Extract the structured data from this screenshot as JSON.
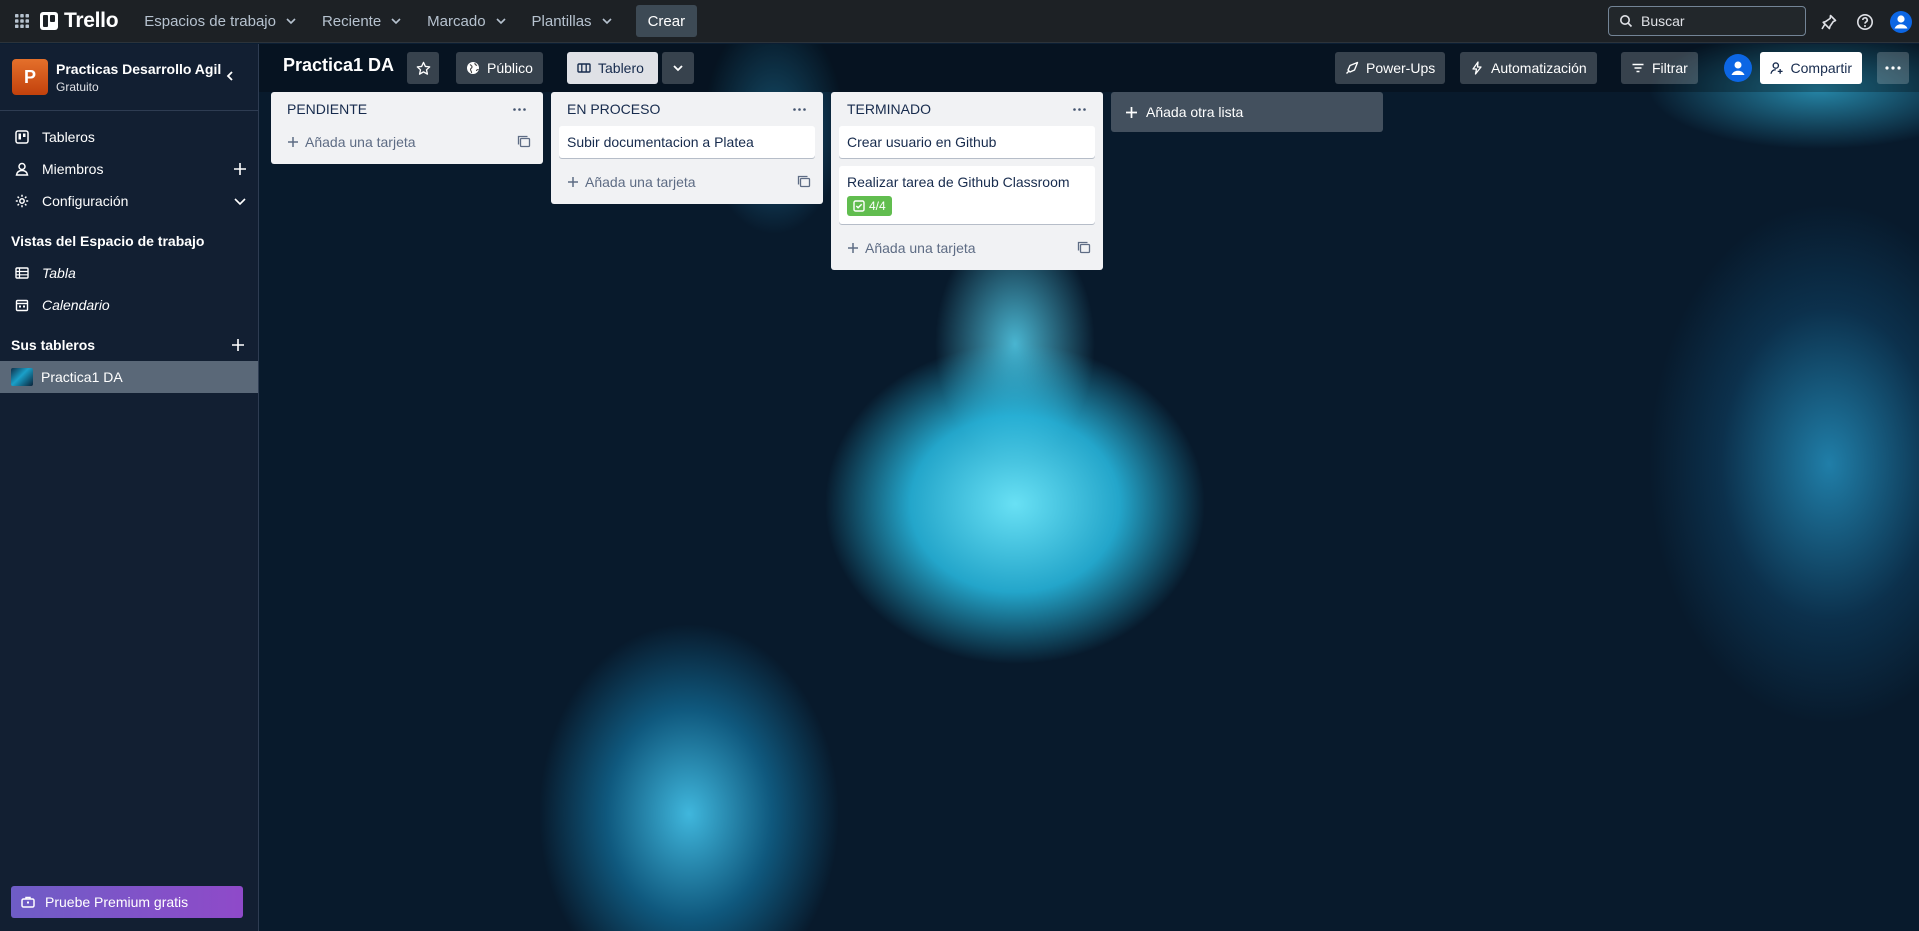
{
  "topbar": {
    "logo_text": "Trello",
    "nav": [
      {
        "label": "Espacios de trabajo"
      },
      {
        "label": "Reciente"
      },
      {
        "label": "Marcado"
      },
      {
        "label": "Plantillas"
      }
    ],
    "create_label": "Crear",
    "search_placeholder": "Buscar"
  },
  "sidebar": {
    "workspace_initial": "P",
    "workspace_name": "Practicas Desarrollo Agil",
    "workspace_plan": "Gratuito",
    "items": [
      {
        "label": "Tableros",
        "icon": "board-icon"
      },
      {
        "label": "Miembros",
        "icon": "member-icon"
      },
      {
        "label": "Configuración",
        "icon": "gear-icon"
      }
    ],
    "views_title": "Vistas del Espacio de trabajo",
    "views": [
      {
        "label": "Tabla",
        "icon": "table-icon"
      },
      {
        "label": "Calendario",
        "icon": "calendar-icon"
      }
    ],
    "boards_title": "Sus tableros",
    "boards": [
      {
        "label": "Practica1 DA"
      }
    ],
    "premium_label": "Pruebe Premium gratis"
  },
  "board": {
    "title": "Practica1 DA",
    "visibility_label": "Público",
    "view_label": "Tablero",
    "powerups_label": "Power-Ups",
    "automation_label": "Automatización",
    "filter_label": "Filtrar",
    "share_label": "Compartir",
    "add_list_label": "Añada otra lista",
    "add_card_label": "Añada una tarjeta",
    "lists": [
      {
        "title": "PENDIENTE",
        "cards": []
      },
      {
        "title": "EN PROCESO",
        "cards": [
          {
            "text": "Subir documentacion a Platea"
          }
        ]
      },
      {
        "title": "TERMINADO",
        "cards": [
          {
            "text": "Crear usuario en Github"
          },
          {
            "text": "Realizar tarea de Github Classroom",
            "checklist": "4/4"
          }
        ]
      }
    ]
  },
  "colors": {
    "topbar_bg": "#1d2125",
    "list_bg": "#f1f2f4",
    "checklist_complete": "#61bd4f",
    "premium_gradient": [
      "#6e5dc6",
      "#8f4ac9"
    ],
    "workspace_avatar": "#e4702b"
  }
}
